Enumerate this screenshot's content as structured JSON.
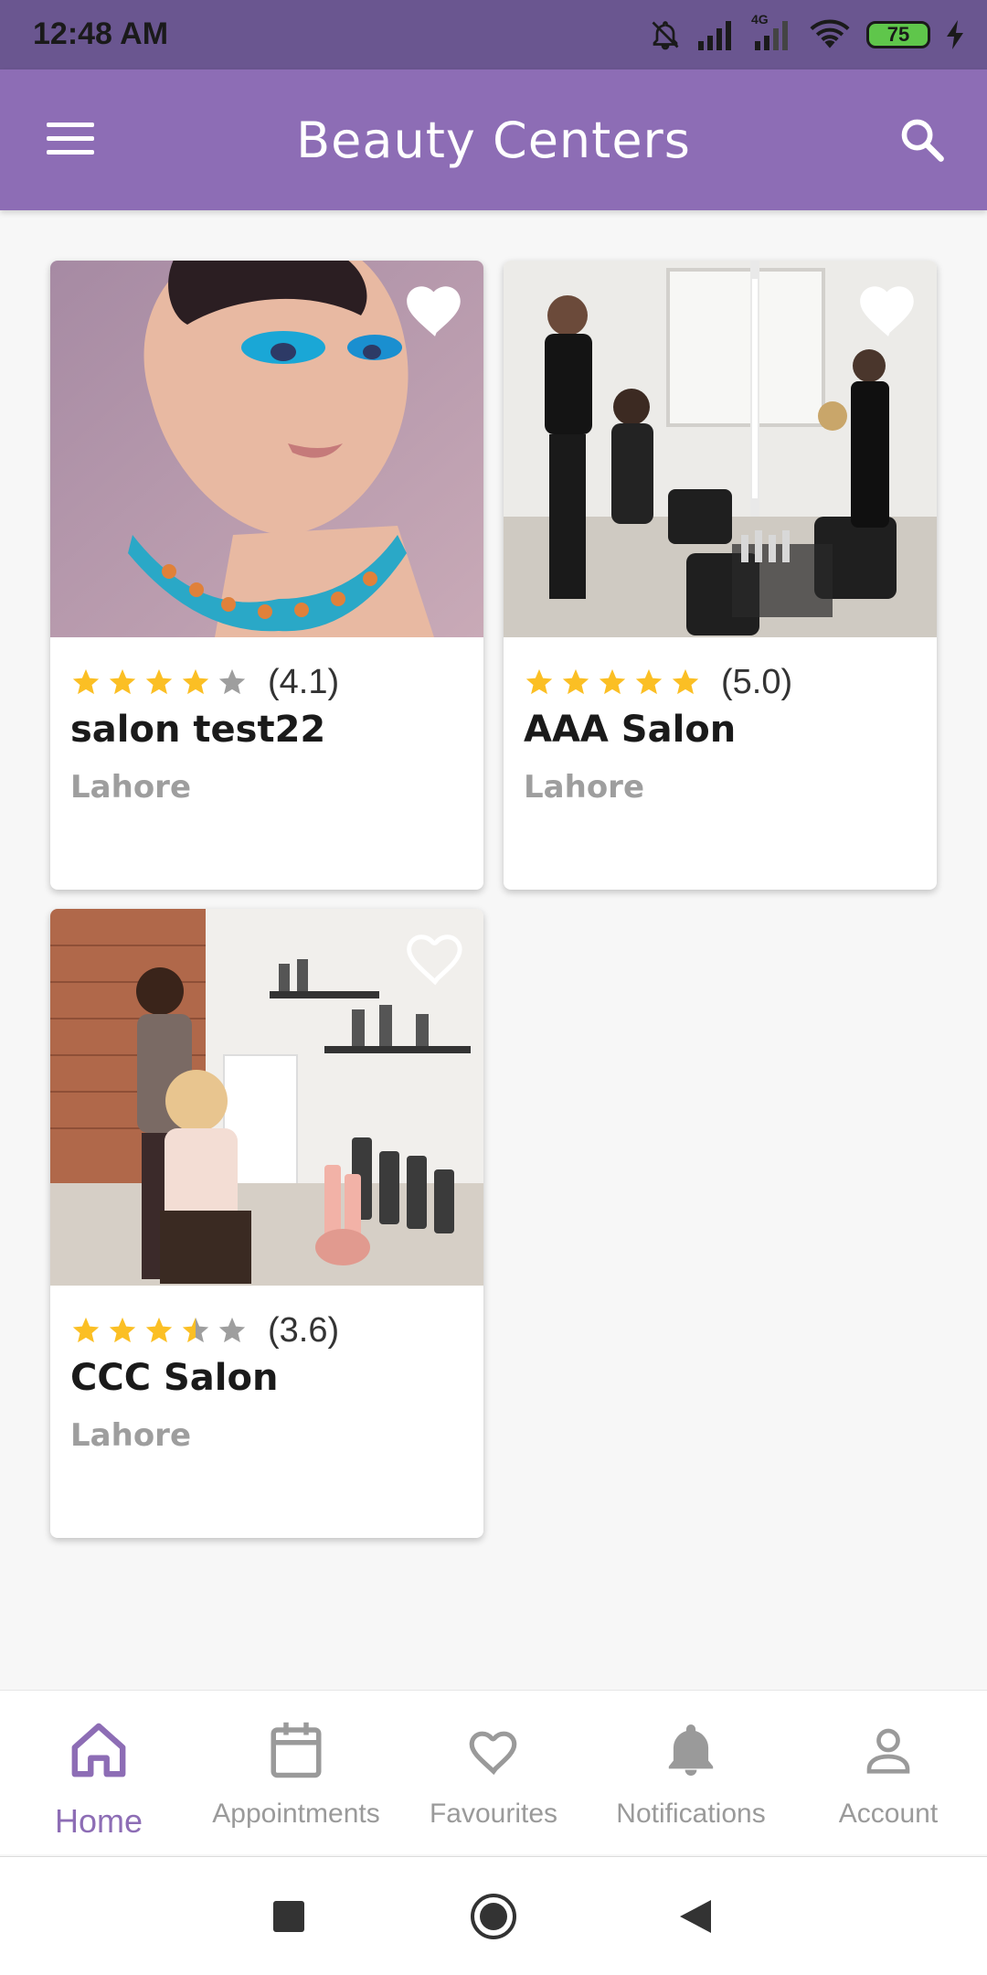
{
  "status_bar": {
    "time": "12:48 AM",
    "network": "4G",
    "battery": "75"
  },
  "app_bar": {
    "title": "Beauty Centers",
    "menu_icon": "hamburger-menu-icon",
    "search_icon": "search-icon"
  },
  "salons": [
    {
      "rating": 4.1,
      "rating_text": "(4.1)",
      "name": "salon test22",
      "city": "Lahore",
      "favourite": true
    },
    {
      "rating": 5.0,
      "rating_text": "(5.0)",
      "name": "AAA Salon",
      "city": "Lahore",
      "favourite": true
    },
    {
      "rating": 3.6,
      "rating_text": "(3.6)",
      "name": "CCC Salon",
      "city": "Lahore",
      "favourite": false
    }
  ],
  "bottom_nav": [
    {
      "label": "Home",
      "icon": "home-icon",
      "active": true
    },
    {
      "label": "Appointments",
      "icon": "calendar-icon",
      "active": false
    },
    {
      "label": "Favourites",
      "icon": "heart-icon",
      "active": false
    },
    {
      "label": "Notifications",
      "icon": "bell-icon",
      "active": false
    },
    {
      "label": "Account",
      "icon": "account-icon",
      "active": false
    }
  ],
  "colors": {
    "primary": "#8d6db5",
    "status_bar": "#6a5690",
    "star": "#fbbf24",
    "star_empty": "#9e9e9e",
    "inactive": "#9a9a9a"
  }
}
